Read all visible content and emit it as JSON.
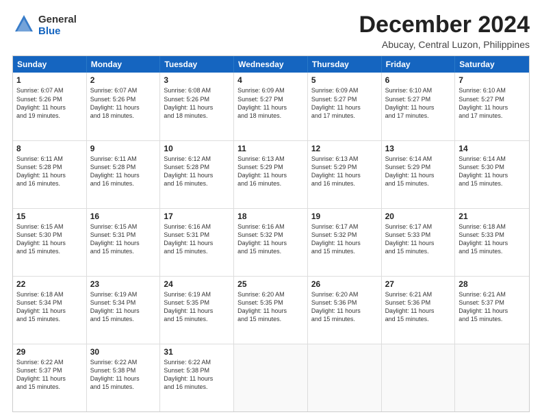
{
  "logo": {
    "line1": "General",
    "line2": "Blue"
  },
  "title": "December 2024",
  "location": "Abucay, Central Luzon, Philippines",
  "header_days": [
    "Sunday",
    "Monday",
    "Tuesday",
    "Wednesday",
    "Thursday",
    "Friday",
    "Saturday"
  ],
  "weeks": [
    [
      {
        "day": "1",
        "lines": [
          "Sunrise: 6:07 AM",
          "Sunset: 5:26 PM",
          "Daylight: 11 hours",
          "and 19 minutes."
        ]
      },
      {
        "day": "2",
        "lines": [
          "Sunrise: 6:07 AM",
          "Sunset: 5:26 PM",
          "Daylight: 11 hours",
          "and 18 minutes."
        ]
      },
      {
        "day": "3",
        "lines": [
          "Sunrise: 6:08 AM",
          "Sunset: 5:26 PM",
          "Daylight: 11 hours",
          "and 18 minutes."
        ]
      },
      {
        "day": "4",
        "lines": [
          "Sunrise: 6:09 AM",
          "Sunset: 5:27 PM",
          "Daylight: 11 hours",
          "and 18 minutes."
        ]
      },
      {
        "day": "5",
        "lines": [
          "Sunrise: 6:09 AM",
          "Sunset: 5:27 PM",
          "Daylight: 11 hours",
          "and 17 minutes."
        ]
      },
      {
        "day": "6",
        "lines": [
          "Sunrise: 6:10 AM",
          "Sunset: 5:27 PM",
          "Daylight: 11 hours",
          "and 17 minutes."
        ]
      },
      {
        "day": "7",
        "lines": [
          "Sunrise: 6:10 AM",
          "Sunset: 5:27 PM",
          "Daylight: 11 hours",
          "and 17 minutes."
        ]
      }
    ],
    [
      {
        "day": "8",
        "lines": [
          "Sunrise: 6:11 AM",
          "Sunset: 5:28 PM",
          "Daylight: 11 hours",
          "and 16 minutes."
        ]
      },
      {
        "day": "9",
        "lines": [
          "Sunrise: 6:11 AM",
          "Sunset: 5:28 PM",
          "Daylight: 11 hours",
          "and 16 minutes."
        ]
      },
      {
        "day": "10",
        "lines": [
          "Sunrise: 6:12 AM",
          "Sunset: 5:28 PM",
          "Daylight: 11 hours",
          "and 16 minutes."
        ]
      },
      {
        "day": "11",
        "lines": [
          "Sunrise: 6:13 AM",
          "Sunset: 5:29 PM",
          "Daylight: 11 hours",
          "and 16 minutes."
        ]
      },
      {
        "day": "12",
        "lines": [
          "Sunrise: 6:13 AM",
          "Sunset: 5:29 PM",
          "Daylight: 11 hours",
          "and 16 minutes."
        ]
      },
      {
        "day": "13",
        "lines": [
          "Sunrise: 6:14 AM",
          "Sunset: 5:29 PM",
          "Daylight: 11 hours",
          "and 15 minutes."
        ]
      },
      {
        "day": "14",
        "lines": [
          "Sunrise: 6:14 AM",
          "Sunset: 5:30 PM",
          "Daylight: 11 hours",
          "and 15 minutes."
        ]
      }
    ],
    [
      {
        "day": "15",
        "lines": [
          "Sunrise: 6:15 AM",
          "Sunset: 5:30 PM",
          "Daylight: 11 hours",
          "and 15 minutes."
        ]
      },
      {
        "day": "16",
        "lines": [
          "Sunrise: 6:15 AM",
          "Sunset: 5:31 PM",
          "Daylight: 11 hours",
          "and 15 minutes."
        ]
      },
      {
        "day": "17",
        "lines": [
          "Sunrise: 6:16 AM",
          "Sunset: 5:31 PM",
          "Daylight: 11 hours",
          "and 15 minutes."
        ]
      },
      {
        "day": "18",
        "lines": [
          "Sunrise: 6:16 AM",
          "Sunset: 5:32 PM",
          "Daylight: 11 hours",
          "and 15 minutes."
        ]
      },
      {
        "day": "19",
        "lines": [
          "Sunrise: 6:17 AM",
          "Sunset: 5:32 PM",
          "Daylight: 11 hours",
          "and 15 minutes."
        ]
      },
      {
        "day": "20",
        "lines": [
          "Sunrise: 6:17 AM",
          "Sunset: 5:33 PM",
          "Daylight: 11 hours",
          "and 15 minutes."
        ]
      },
      {
        "day": "21",
        "lines": [
          "Sunrise: 6:18 AM",
          "Sunset: 5:33 PM",
          "Daylight: 11 hours",
          "and 15 minutes."
        ]
      }
    ],
    [
      {
        "day": "22",
        "lines": [
          "Sunrise: 6:18 AM",
          "Sunset: 5:34 PM",
          "Daylight: 11 hours",
          "and 15 minutes."
        ]
      },
      {
        "day": "23",
        "lines": [
          "Sunrise: 6:19 AM",
          "Sunset: 5:34 PM",
          "Daylight: 11 hours",
          "and 15 minutes."
        ]
      },
      {
        "day": "24",
        "lines": [
          "Sunrise: 6:19 AM",
          "Sunset: 5:35 PM",
          "Daylight: 11 hours",
          "and 15 minutes."
        ]
      },
      {
        "day": "25",
        "lines": [
          "Sunrise: 6:20 AM",
          "Sunset: 5:35 PM",
          "Daylight: 11 hours",
          "and 15 minutes."
        ]
      },
      {
        "day": "26",
        "lines": [
          "Sunrise: 6:20 AM",
          "Sunset: 5:36 PM",
          "Daylight: 11 hours",
          "and 15 minutes."
        ]
      },
      {
        "day": "27",
        "lines": [
          "Sunrise: 6:21 AM",
          "Sunset: 5:36 PM",
          "Daylight: 11 hours",
          "and 15 minutes."
        ]
      },
      {
        "day": "28",
        "lines": [
          "Sunrise: 6:21 AM",
          "Sunset: 5:37 PM",
          "Daylight: 11 hours",
          "and 15 minutes."
        ]
      }
    ],
    [
      {
        "day": "29",
        "lines": [
          "Sunrise: 6:22 AM",
          "Sunset: 5:37 PM",
          "Daylight: 11 hours",
          "and 15 minutes."
        ]
      },
      {
        "day": "30",
        "lines": [
          "Sunrise: 6:22 AM",
          "Sunset: 5:38 PM",
          "Daylight: 11 hours",
          "and 15 minutes."
        ]
      },
      {
        "day": "31",
        "lines": [
          "Sunrise: 6:22 AM",
          "Sunset: 5:38 PM",
          "Daylight: 11 hours",
          "and 16 minutes."
        ]
      },
      {
        "day": "",
        "lines": []
      },
      {
        "day": "",
        "lines": []
      },
      {
        "day": "",
        "lines": []
      },
      {
        "day": "",
        "lines": []
      }
    ]
  ]
}
